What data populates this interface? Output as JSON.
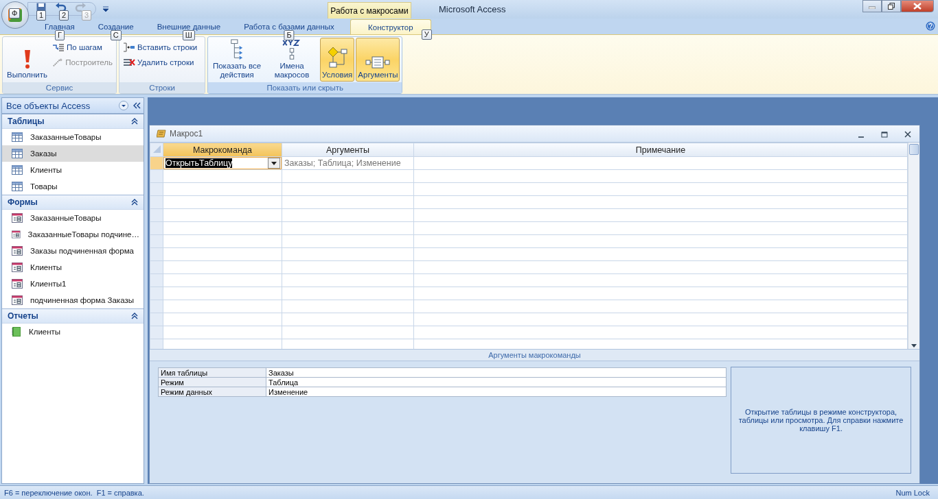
{
  "window": {
    "title": "Microsoft Access",
    "contextual_tab_group": "Работа с макросами"
  },
  "office_button": {
    "keytip": "Ф"
  },
  "quick_access": [
    {
      "kind": "save",
      "keytip": "1",
      "disabled": false
    },
    {
      "kind": "undo",
      "keytip": "2",
      "disabled": false
    },
    {
      "kind": "redo",
      "keytip": "3",
      "disabled": true
    }
  ],
  "tabs": [
    {
      "label": "Главная",
      "keytip": "Г",
      "selected": false
    },
    {
      "label": "Создание",
      "keytip": "С",
      "selected": false
    },
    {
      "label": "Внешние данные",
      "keytip": "Ш",
      "selected": false
    },
    {
      "label": "Работа с базами данных",
      "keytip": "Б",
      "selected": false
    },
    {
      "label": "Конструктор",
      "keytip": "У",
      "selected": true
    }
  ],
  "ribbon_groups": [
    {
      "label": "Сервис",
      "buttons": [
        {
          "label": "Выполнить",
          "kind": "run",
          "disabled": false
        },
        {
          "label": "По шагам",
          "kind": "step",
          "disabled": false
        },
        {
          "label": "Построитель",
          "kind": "builder",
          "disabled": true
        }
      ]
    },
    {
      "label": "Строки",
      "buttons": [
        {
          "label": "Вставить строки",
          "kind": "insert-rows",
          "disabled": false
        },
        {
          "label": "Удалить строки",
          "kind": "delete-rows",
          "disabled": false
        }
      ]
    },
    {
      "label": "Показать или скрыть",
      "active": true,
      "buttons": [
        {
          "label": "Показать все действия",
          "kind": "show-all",
          "on": false
        },
        {
          "label": "Имена макросов",
          "kind": "names",
          "on": false
        },
        {
          "label": "Условия",
          "kind": "conditions",
          "on": true
        },
        {
          "label": "Аргументы",
          "kind": "arguments",
          "on": true
        }
      ]
    }
  ],
  "nav_pane": {
    "title": "Все объекты Access",
    "sections": [
      {
        "label": "Таблицы",
        "kind": "table",
        "expanded": true,
        "items": [
          {
            "label": "ЗаказанныеТовары",
            "selected": false
          },
          {
            "label": "Заказы",
            "selected": true
          },
          {
            "label": "Клиенты",
            "selected": false
          },
          {
            "label": "Товары",
            "selected": false
          }
        ]
      },
      {
        "label": "Формы",
        "kind": "form",
        "expanded": true,
        "items": [
          {
            "label": "ЗаказанныеТовары",
            "selected": false
          },
          {
            "label": "ЗаказанныеТовары подчине…",
            "selected": false
          },
          {
            "label": "Заказы подчиненная форма",
            "selected": false
          },
          {
            "label": "Клиенты",
            "selected": false
          },
          {
            "label": "Клиенты1",
            "selected": false
          },
          {
            "label": "подчиненная форма Заказы",
            "selected": false
          }
        ]
      },
      {
        "label": "Отчеты",
        "kind": "report",
        "expanded": true,
        "items": [
          {
            "label": "Клиенты",
            "selected": false
          }
        ]
      }
    ]
  },
  "macro_window": {
    "title": "Макрос1",
    "columns": [
      "Макрокоманда",
      "Аргументы",
      "Примечание"
    ],
    "rows": [
      {
        "action": "ОткрытьТаблицу",
        "arguments": "Заказы; Таблица; Изменение",
        "selected": true
      }
    ],
    "arguments_title": "Аргументы макрокоманды",
    "arguments": [
      {
        "name": "Имя таблицы",
        "value": "Заказы"
      },
      {
        "name": "Режим",
        "value": "Таблица"
      },
      {
        "name": "Режим данных",
        "value": "Изменение"
      }
    ],
    "help": "Открытие таблицы в режиме конструктора, таблицы или просмотра. Для справки нажмите клавишу F1."
  },
  "status_bar": {
    "message": "F6 = переключение окон.  F1 = справка.",
    "indicator": "Num Lock"
  }
}
